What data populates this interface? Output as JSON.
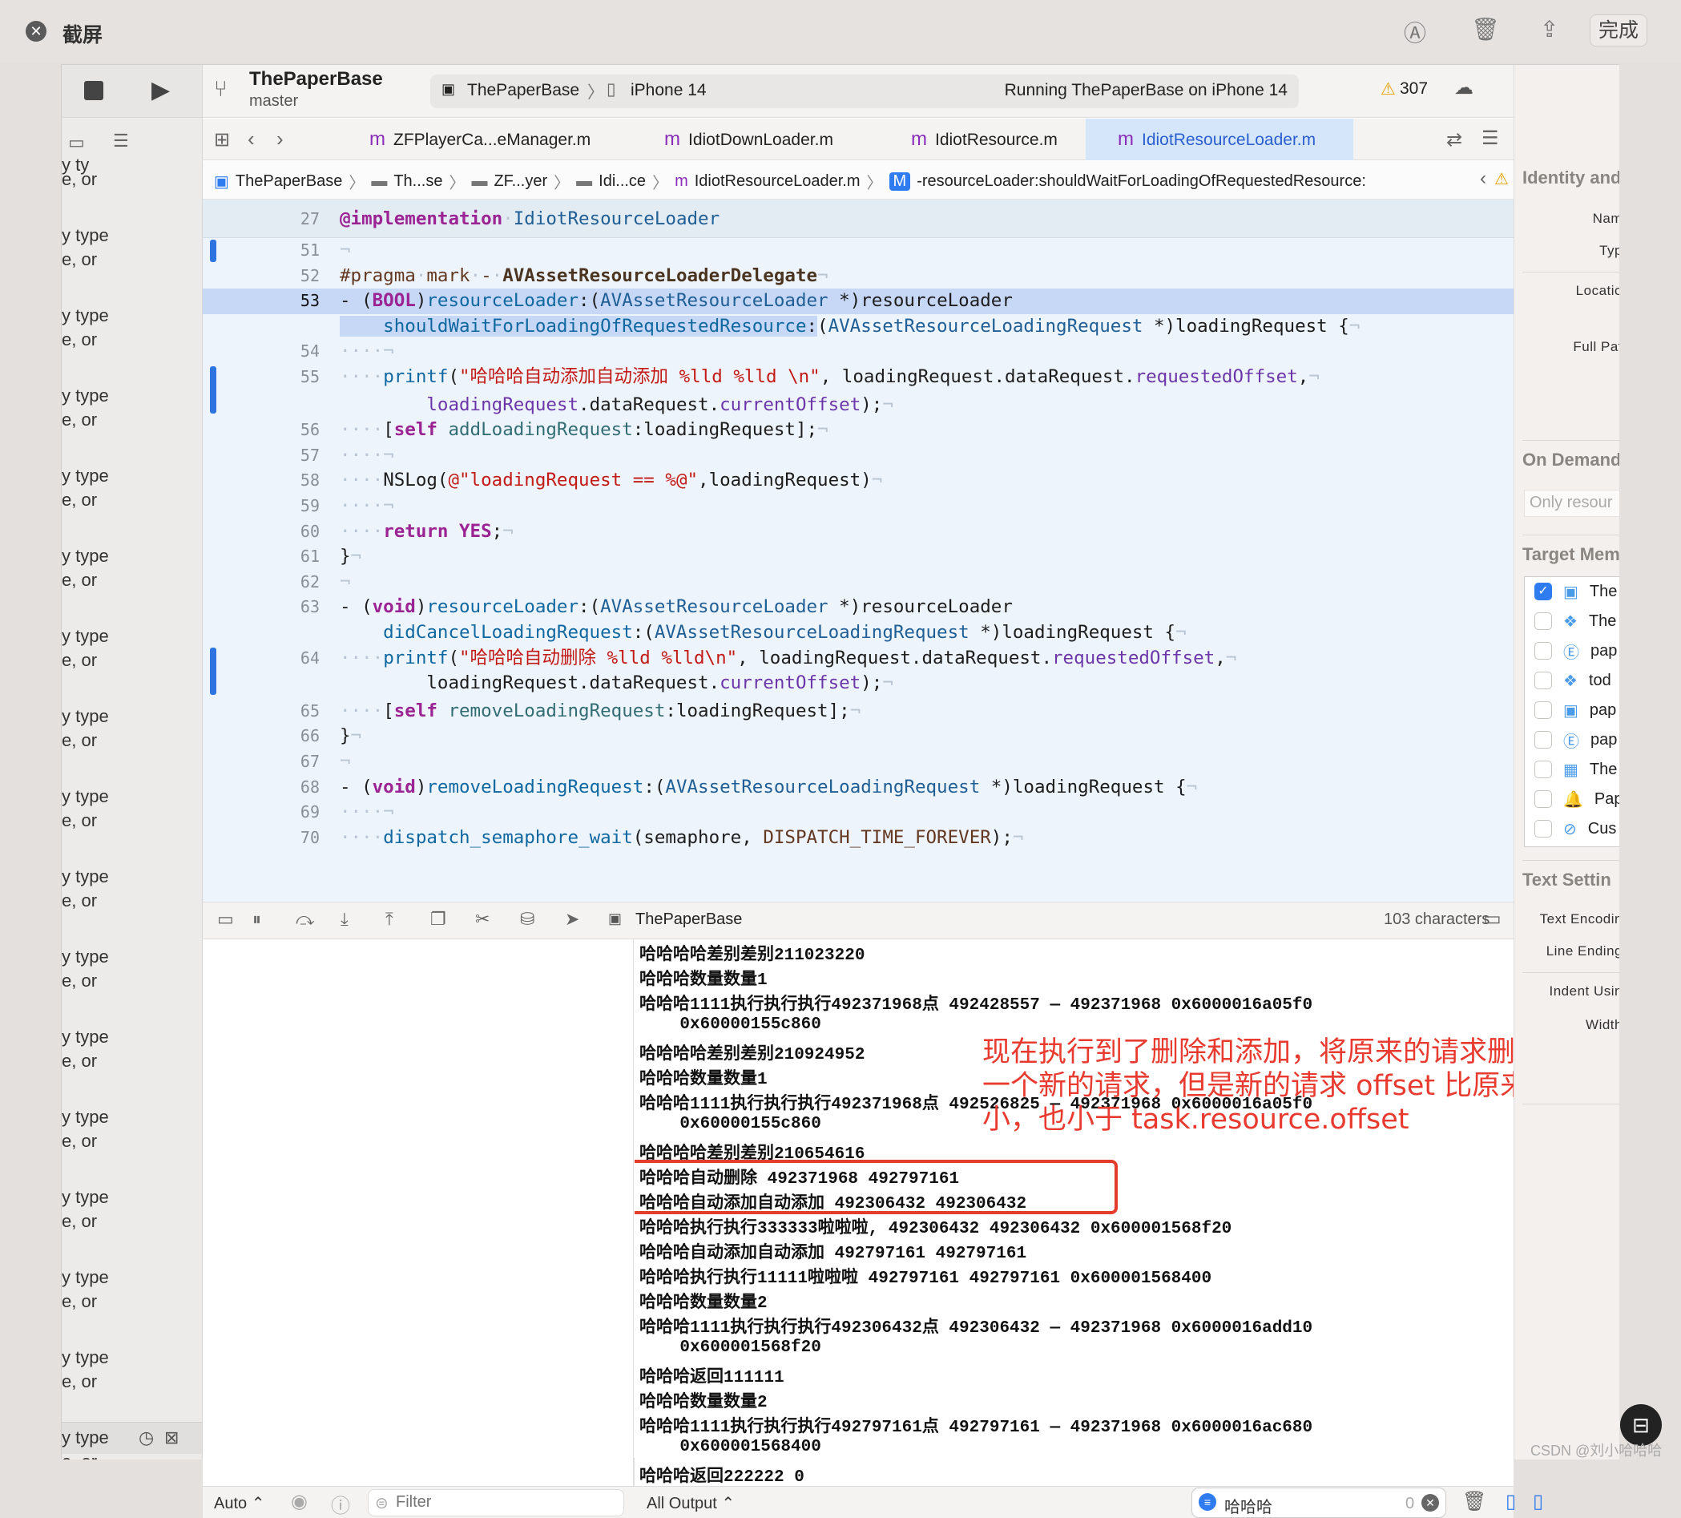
{
  "screenshot": {
    "title": "截屏",
    "done_label": "完成"
  },
  "sidebar": {
    "items": [
      "y ty",
      "e, or",
      "y type",
      "e, or",
      "y type",
      "e, or",
      "y type",
      "e, or",
      "y type",
      "e, or",
      "y type",
      "e, or",
      "y type",
      "e, or",
      "y type",
      "e, or",
      "y type",
      "e, or",
      "y type",
      "e, or",
      "y type",
      "e, or",
      "y type",
      "e, or",
      "y type",
      "e, or",
      "y type",
      "e, or",
      "y type",
      "e, or",
      "y type",
      "e, or",
      "y type",
      "e, or"
    ]
  },
  "toolbar": {
    "project": "ThePaperBase",
    "branch": "master",
    "scheme": "ThePaperBase",
    "device": "iPhone 14",
    "status": "Running ThePaperBase on iPhone 14",
    "warnings": "307"
  },
  "tabs": [
    {
      "label": "ZFPlayerCa...eManager.m",
      "active": false
    },
    {
      "label": "IdiotDownLoader.m",
      "active": false
    },
    {
      "label": "IdiotResource.m",
      "active": false
    },
    {
      "label": "IdiotResourceLoader.m",
      "active": true
    }
  ],
  "jumpbar": [
    "ThePaperBase",
    "Th...se",
    "ZF...yer",
    "Idi...ce",
    "IdiotResourceLoader.m",
    "-resourceLoader:shouldWaitForLoadingOfRequestedResource:"
  ],
  "editor": {
    "lines": [
      {
        "n": "27",
        "sticky": true,
        "segs": [
          [
            "k",
            "@implementation"
          ],
          [
            "ws",
            "·"
          ],
          [
            "cl",
            "IdiotResourceLoader"
          ]
        ]
      },
      {
        "n": "51",
        "chg": true,
        "segs": [
          [
            "ws",
            "¬"
          ]
        ]
      },
      {
        "n": "52",
        "segs": [
          [
            "p",
            "#pragma"
          ],
          [
            "ws",
            "·"
          ],
          [
            "p",
            "mark"
          ],
          [
            "ws",
            "·"
          ],
          [
            "p",
            "-"
          ],
          [
            "ws",
            "·"
          ],
          [
            "pb",
            "AVAssetResourceLoaderDelegate"
          ],
          [
            "ws",
            "¬"
          ]
        ]
      },
      {
        "n": "53",
        "cur": true,
        "hl": true,
        "segs": [
          [
            "pl",
            "- ("
          ],
          [
            "k",
            "BOOL"
          ],
          [
            "pl",
            ")"
          ],
          [
            "f",
            "resourceLoader"
          ],
          [
            "pl",
            ":("
          ],
          [
            "cl",
            "AVAssetResourceLoader"
          ],
          [
            "pl",
            " *)resourceLoader"
          ]
        ]
      },
      {
        "n": "",
        "selcont": true,
        "segs": [
          [
            "f",
            "    shouldWaitForLoadingOfRequestedResource"
          ],
          [
            "pl",
            ":"
          ],
          [
            "pl",
            "("
          ],
          [
            "cl",
            "AVAssetResourceLoadingRequest"
          ],
          [
            "pl",
            " *)loadingRequest {"
          ],
          [
            "ws",
            "¬"
          ]
        ]
      },
      {
        "n": "54",
        "segs": [
          [
            "ws",
            "····¬"
          ]
        ]
      },
      {
        "n": "55",
        "chg": true,
        "chgspan": 2,
        "segs": [
          [
            "ws",
            "····"
          ],
          [
            "f",
            "printf"
          ],
          [
            "pl",
            "("
          ],
          [
            "s",
            "\"哈哈哈自动添加自动添加 %lld %lld \\n\""
          ],
          [
            "pl",
            ", loadingRequest.dataRequest."
          ],
          [
            "pr",
            "requestedOffset"
          ],
          [
            "pl",
            ","
          ],
          [
            "ws",
            "¬"
          ]
        ]
      },
      {
        "n": "",
        "segs": [
          [
            "pl",
            "        "
          ],
          [
            "pr",
            "loadingRequest"
          ],
          [
            "pl",
            ".dataRequest."
          ],
          [
            "pr",
            "currentOffset"
          ],
          [
            "pl",
            ");"
          ],
          [
            "ws",
            "¬"
          ]
        ]
      },
      {
        "n": "56",
        "segs": [
          [
            "ws",
            "····"
          ],
          [
            "pl",
            "["
          ],
          [
            "k",
            "self"
          ],
          [
            "pl",
            " "
          ],
          [
            "m2",
            "addLoadingRequest"
          ],
          [
            "pl",
            ":loadingRequest];"
          ],
          [
            "ws",
            "¬"
          ]
        ]
      },
      {
        "n": "57",
        "segs": [
          [
            "ws",
            "····¬"
          ]
        ]
      },
      {
        "n": "58",
        "segs": [
          [
            "ws",
            "····"
          ],
          [
            "pl",
            "NSLog("
          ],
          [
            "s",
            "@\"loadingRequest == %@\""
          ],
          [
            "pl",
            ",loadingRequest)"
          ],
          [
            "ws",
            "¬"
          ]
        ]
      },
      {
        "n": "59",
        "segs": [
          [
            "ws",
            "····¬"
          ]
        ]
      },
      {
        "n": "60",
        "segs": [
          [
            "ws",
            "····"
          ],
          [
            "k",
            "return"
          ],
          [
            "pl",
            " "
          ],
          [
            "k",
            "YES"
          ],
          [
            "pl",
            ";"
          ],
          [
            "ws",
            "¬"
          ]
        ]
      },
      {
        "n": "61",
        "segs": [
          [
            "pl",
            "}"
          ],
          [
            "ws",
            "¬"
          ]
        ]
      },
      {
        "n": "62",
        "segs": [
          [
            "ws",
            "¬"
          ]
        ]
      },
      {
        "n": "63",
        "segs": [
          [
            "pl",
            "- ("
          ],
          [
            "k",
            "void"
          ],
          [
            "pl",
            ")"
          ],
          [
            "f",
            "resourceLoader"
          ],
          [
            "pl",
            ":("
          ],
          [
            "cl",
            "AVAssetResourceLoader"
          ],
          [
            "pl",
            " *)resourceLoader"
          ]
        ]
      },
      {
        "n": "",
        "segs": [
          [
            "f",
            "    didCancelLoadingRequest"
          ],
          [
            "pl",
            ":("
          ],
          [
            "cl",
            "AVAssetResourceLoadingRequest"
          ],
          [
            "pl",
            " *)loadingRequest {"
          ],
          [
            "ws",
            "¬"
          ]
        ]
      },
      {
        "n": "64",
        "chg": true,
        "chgspan": 2,
        "segs": [
          [
            "ws",
            "····"
          ],
          [
            "f",
            "printf"
          ],
          [
            "pl",
            "("
          ],
          [
            "s",
            "\"哈哈哈自动删除 %lld %lld\\n\""
          ],
          [
            "pl",
            ", loadingRequest.dataRequest."
          ],
          [
            "pr",
            "requestedOffset"
          ],
          [
            "pl",
            ","
          ],
          [
            "ws",
            "¬"
          ]
        ]
      },
      {
        "n": "",
        "segs": [
          [
            "pl",
            "        loadingRequest.dataRequest."
          ],
          [
            "pr",
            "currentOffset"
          ],
          [
            "pl",
            ");"
          ],
          [
            "ws",
            "¬"
          ]
        ]
      },
      {
        "n": "65",
        "segs": [
          [
            "ws",
            "····"
          ],
          [
            "pl",
            "["
          ],
          [
            "k",
            "self"
          ],
          [
            "pl",
            " "
          ],
          [
            "m2",
            "removeLoadingRequest"
          ],
          [
            "pl",
            ":loadingRequest];"
          ],
          [
            "ws",
            "¬"
          ]
        ]
      },
      {
        "n": "66",
        "segs": [
          [
            "pl",
            "}"
          ],
          [
            "ws",
            "¬"
          ]
        ]
      },
      {
        "n": "67",
        "segs": [
          [
            "ws",
            "¬"
          ]
        ]
      },
      {
        "n": "68",
        "segs": [
          [
            "pl",
            "- ("
          ],
          [
            "k",
            "void"
          ],
          [
            "pl",
            ")"
          ],
          [
            "f",
            "removeLoadingRequest"
          ],
          [
            "pl",
            ":("
          ],
          [
            "cl",
            "AVAssetResourceLoadingRequest"
          ],
          [
            "pl",
            " *)loadingRequest {"
          ],
          [
            "ws",
            "¬"
          ]
        ]
      },
      {
        "n": "69",
        "segs": [
          [
            "ws",
            "····¬"
          ]
        ]
      },
      {
        "n": "70",
        "segs": [
          [
            "ws",
            "····"
          ],
          [
            "f",
            "dispatch_semaphore_wait"
          ],
          [
            "pl",
            "(semaphore, "
          ],
          [
            "p",
            "DISPATCH_TIME_FOREVER"
          ],
          [
            "pl",
            ");"
          ],
          [
            "ws",
            "¬"
          ]
        ]
      }
    ]
  },
  "debugbar": {
    "target": "ThePaperBase",
    "chars": "103 characters"
  },
  "console": {
    "lines": [
      "哈哈哈哈差别差别211023220",
      "哈哈哈数量数量1",
      "哈哈哈1111执行执行执行492371968点 492428557 — 492371968 0x6000016a05f0",
      "    0x60000155c860",
      "哈哈哈哈差别差别210924952",
      "哈哈哈数量数量1",
      "哈哈哈1111执行执行执行492371968点 492526825 — 492371968 0x6000016a05f0",
      "    0x60000155c860",
      "哈哈哈哈差别差别210654616",
      "哈哈哈自动删除 492371968 492797161",
      "哈哈哈自动添加自动添加 492306432 492306432",
      "哈哈哈执行执行333333啦啦啦, 492306432 492306432 0x600001568f20",
      "哈哈哈自动添加自动添加 492797161 492797161",
      "哈哈哈执行执行11111啦啦啦 492797161 492797161 0x600001568400",
      "哈哈哈数量数量2",
      "哈哈哈1111执行执行执行492306432点 492306432 — 492371968 0x6000016add10",
      "    0x600001568f20",
      "哈哈哈返回111111",
      "哈哈哈数量数量2",
      "哈哈哈1111执行执行执行492797161点 492797161 — 492371968 0x6000016ac680",
      "    0x600001568400",
      "哈哈哈返回222222 0"
    ],
    "annotation": "现在执行到了删除和添加，将原来的请求删除了，添加了一个新的请求，但是新的请求 offset 比原来的请求 offset 小，也小于 task.resource.offset"
  },
  "bottombar": {
    "auto": "Auto ⌃",
    "filter_placeholder": "Filter",
    "output": "All Output ⌃",
    "search": "哈哈哈",
    "count": "0"
  },
  "inspector": {
    "identity": "Identity and",
    "name": "Nam",
    "type": "Typ",
    "location": "Locatio",
    "fullpath": "Full Pat",
    "ondemand": "On Demand",
    "ondemand_placeholder": "Only resour",
    "target": "Target Mem",
    "targets": [
      {
        "label": "The",
        "checked": true,
        "icon": "app-icon"
      },
      {
        "label": "The",
        "checked": false,
        "icon": "framework-icon"
      },
      {
        "label": "pap",
        "checked": false,
        "icon": "extension-icon"
      },
      {
        "label": "tod",
        "checked": false,
        "icon": "framework-icon"
      },
      {
        "label": "pap",
        "checked": false,
        "icon": "app-icon"
      },
      {
        "label": "pap",
        "checked": false,
        "icon": "extension-icon"
      },
      {
        "label": "The",
        "checked": false,
        "icon": "widget-icon"
      },
      {
        "label": "Pap",
        "checked": false,
        "icon": "notification-icon"
      },
      {
        "label": "Cus",
        "checked": false,
        "icon": "safari-icon"
      }
    ],
    "text": "Text Settin",
    "encoding": "Text Encodin",
    "lineend": "Line Ending",
    "indent": "Indent Usin",
    "width": "Width"
  },
  "watermark": "CSDN @刘小哈哈哈",
  "colors": {
    "accent": "#2f7bf0",
    "annotation": "#e83a2e",
    "editor_bg": "#edf4fc"
  }
}
